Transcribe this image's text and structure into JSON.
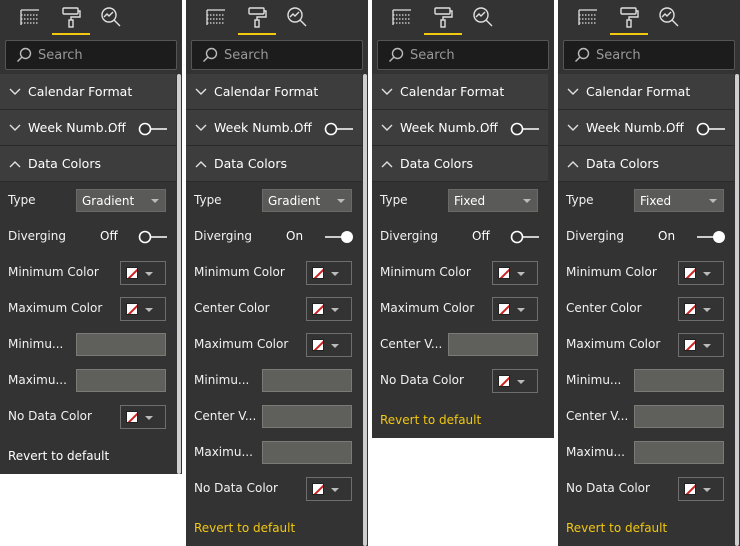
{
  "search_placeholder": "Search",
  "accent_color": "#f2c811",
  "panels": [
    {
      "calendar_format": "Calendar Format",
      "week_numbers": "Week Numb...",
      "week_numbers_state": "Off",
      "data_colors": "Data Colors",
      "type_label": "Type",
      "type_value": "Gradient",
      "diverging_label": "Diverging",
      "diverging_state": "Off",
      "rows": [
        "Minimum Color",
        "Maximum Color",
        "Minimu...",
        "Maximu...",
        "No Data Color"
      ],
      "revert": "Revert to default"
    },
    {
      "calendar_format": "Calendar Format",
      "week_numbers": "Week Numb...",
      "week_numbers_state": "Off",
      "data_colors": "Data Colors",
      "type_label": "Type",
      "type_value": "Gradient",
      "diverging_label": "Diverging",
      "diverging_state": "On",
      "rows": [
        "Minimum Color",
        "Center Color",
        "Maximum Color",
        "Minimu...",
        "Center V...",
        "Maximu...",
        "No Data Color"
      ],
      "revert": "Revert to default"
    },
    {
      "calendar_format": "Calendar Format",
      "week_numbers": "Week Numb...",
      "week_numbers_state": "Off",
      "data_colors": "Data Colors",
      "type_label": "Type",
      "type_value": "Fixed",
      "diverging_label": "Diverging",
      "diverging_state": "Off",
      "rows": [
        "Minimum Color",
        "Maximum Color",
        "Center V...",
        "No Data Color"
      ],
      "revert": "Revert to default"
    },
    {
      "calendar_format": "Calendar Format",
      "week_numbers": "Week Numb...",
      "week_numbers_state": "Off",
      "data_colors": "Data Colors",
      "type_label": "Type",
      "type_value": "Fixed",
      "diverging_label": "Diverging",
      "diverging_state": "On",
      "rows": [
        "Minimum Color",
        "Center Color",
        "Maximum Color",
        "Minimu...",
        "Center V...",
        "Maximu...",
        "No Data Color"
      ],
      "revert": "Revert to default"
    }
  ]
}
